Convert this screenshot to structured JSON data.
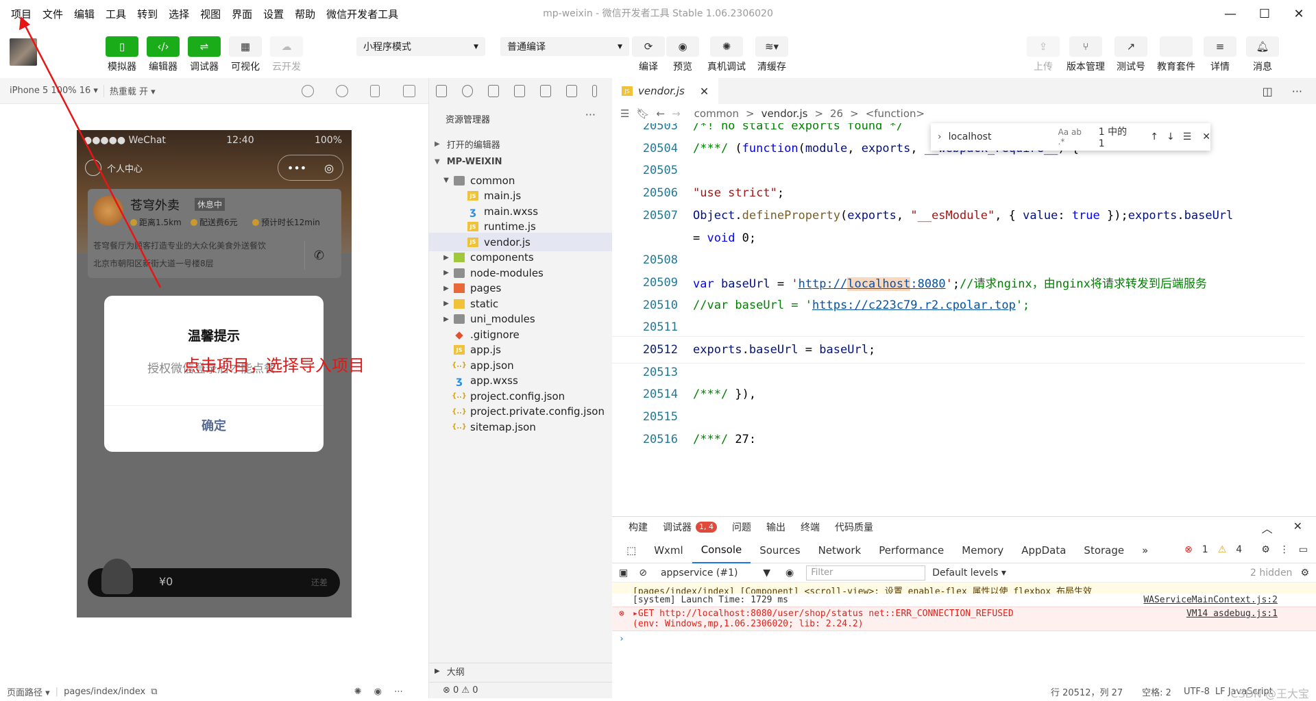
{
  "menubar": {
    "items": [
      "项目",
      "文件",
      "编辑",
      "工具",
      "转到",
      "选择",
      "视图",
      "界面",
      "设置",
      "帮助",
      "微信开发者工具"
    ]
  },
  "window": {
    "title": "mp-weixin - 微信开发者工具 Stable 1.06.2306020",
    "controls": {
      "minimize": "—",
      "maximize": "☐",
      "close": "✕"
    }
  },
  "toolbar": {
    "simulator": "模拟器",
    "editor": "编辑器",
    "debugger": "调试器",
    "visual": "可视化",
    "cloud": "云开发",
    "mode": "小程序模式",
    "compile_mode": "普通编译",
    "compile": "编译",
    "preview": "预览",
    "real_debug": "真机调试",
    "clear_cache": "清缓存",
    "upload": "上传",
    "version": "版本管理",
    "test": "测试号",
    "edu": "教育套件",
    "details": "详情",
    "messages": "消息"
  },
  "simbar": {
    "device": "iPhone 5 100% 16 ▾",
    "hotreload": "热重载 开 ▾"
  },
  "phone": {
    "status": {
      "carrier": "●●●●● WeChat",
      "time": "12:40",
      "battery": "100%"
    },
    "user": "个人中心",
    "shop": {
      "name": "苍穹外卖",
      "badge": "休息中",
      "distance": "距离1.5km",
      "fee": "配送费6元",
      "time": "预计时长12min",
      "desc": "苍穹餐厅为顾客打造专业的大众化美食外送餐饮",
      "address": "北京市朝阳区新街大道一号楼8层"
    },
    "dialog": {
      "title": "温馨提示",
      "message": "授权微信登录后才能点餐!",
      "ok": "确定"
    },
    "cart": {
      "price": "¥0",
      "note": "还差"
    }
  },
  "annotation": "点击项目，选择导入项目",
  "sim_footer": {
    "path_label": "页面路径 ▾",
    "path": "pages/index/index"
  },
  "explorer": {
    "title": "资源管理器",
    "open_editors": "打开的编辑器",
    "project": "MP-WEIXIN",
    "tree": [
      {
        "name": "common",
        "type": "folder",
        "depth": 1,
        "open": true
      },
      {
        "name": "main.js",
        "type": "js",
        "depth": 2
      },
      {
        "name": "main.wxss",
        "type": "wxss",
        "depth": 2
      },
      {
        "name": "runtime.js",
        "type": "js",
        "depth": 2
      },
      {
        "name": "vendor.js",
        "type": "js",
        "depth": 2,
        "selected": true
      },
      {
        "name": "components",
        "type": "fcom",
        "depth": 1
      },
      {
        "name": "node-modules",
        "type": "folder",
        "depth": 1
      },
      {
        "name": "pages",
        "type": "fpages",
        "depth": 1
      },
      {
        "name": "static",
        "type": "fstatic",
        "depth": 1
      },
      {
        "name": "uni_modules",
        "type": "folder",
        "depth": 1
      },
      {
        "name": ".gitignore",
        "type": "git",
        "depth": 1
      },
      {
        "name": "app.js",
        "type": "js",
        "depth": 1
      },
      {
        "name": "app.json",
        "type": "json",
        "depth": 1
      },
      {
        "name": "app.wxss",
        "type": "wxss",
        "depth": 1
      },
      {
        "name": "project.config.json",
        "type": "json",
        "depth": 1
      },
      {
        "name": "project.private.config.json",
        "type": "json",
        "depth": 1
      },
      {
        "name": "sitemap.json",
        "type": "json",
        "depth": 1
      }
    ],
    "outline": "大纲",
    "problems": "⊗ 0 ⚠ 0"
  },
  "editor": {
    "tab": "vendor.js",
    "breadcrumb": [
      "common",
      ">",
      "vendor.js",
      ">",
      "26",
      ">",
      "<function>"
    ],
    "find": {
      "query": "localhost",
      "count": "1 中的 1"
    },
    "lines": [
      {
        "n": "20503",
        "html": "<span class='cm'>/*! no static exports found */</span>"
      },
      {
        "n": "20504",
        "html": "<span class='cm'>/***/</span> (<span class='kw'>function</span>(<span class='vr'>module</span>, <span class='vr'>exports</span>, <span class='vr'>__webpack_require__</span>) {"
      },
      {
        "n": "20505",
        "html": ""
      },
      {
        "n": "20506",
        "html": "<span class='st'>\"use strict\"</span>;"
      },
      {
        "n": "20507",
        "html": "<span class='vr'>Object</span>.<span class='fn'>defineProperty</span>(<span class='vr'>exports</span>, <span class='st'>\"__esModule\"</span>, { <span class='vr'>value</span>: <span class='kw'>true</span> });<span class='vr'>exports</span>.<span class='vr'>baseUrl</span>"
      },
      {
        "n": "",
        "html": "= <span class='kw'>void</span> 0;"
      },
      {
        "n": "20508",
        "html": ""
      },
      {
        "n": "20509",
        "html": "<span class='kw'>var</span> <span class='vr'>baseUrl</span> = <span class='st'>'<span class='ur'>http://<span class='hl'>localhost</span>:8080</span>'</span>;<span class='cm'>//请求nginx，由nginx将请求转发到后端服务</span>"
      },
      {
        "n": "20510",
        "html": "<span class='cm'>//var baseUrl = '<span class='ur'>https://c223c79.r2.cpolar.top</span>';</span>"
      },
      {
        "n": "20511",
        "html": ""
      },
      {
        "n": "20512",
        "html": "<span class='vr'>exports</span>.<span class='vr'>baseUrl</span> = <span class='vr'>baseUrl</span>;",
        "current": true
      },
      {
        "n": "20513",
        "html": ""
      },
      {
        "n": "20514",
        "html": "<span class='cm'>/***/</span> }),"
      },
      {
        "n": "20515",
        "html": ""
      },
      {
        "n": "20516",
        "html": "<span class='cm'>/***/</span> 27:"
      }
    ]
  },
  "panel": {
    "tabs": [
      "构建",
      "调试器",
      "问题",
      "输出",
      "终端",
      "代码质量"
    ],
    "badge": "1, 4",
    "devtabs": [
      "Wxml",
      "Console",
      "Sources",
      "Network",
      "Performance",
      "Memory",
      "AppData",
      "Storage",
      "»"
    ],
    "errors": "1",
    "warnings": "4",
    "context": "appservice (#1)",
    "filter_placeholder": "Filter",
    "levels": "Default levels ▾",
    "hidden": "2 hidden",
    "logs": [
      {
        "text": "[pages/index/index] [Component] <scroll-view>: 设置 enable-flex 属性以使 flexbox 布局生效",
        "src": "",
        "type": "warn"
      },
      {
        "text": "[system] Launch Time: 1729 ms",
        "src": "WAServiceMainContext.js:2",
        "type": "info"
      },
      {
        "text": "▸GET http://localhost:8080/user/shop/status net::ERR_CONNECTION_REFUSED",
        "text2": "(env: Windows,mp,1.06.2306020; lib: 2.24.2)",
        "src": "VM14 asdebug.js:1",
        "type": "err"
      }
    ],
    "prompt": "›"
  },
  "status": {
    "pos": "行 20512，列 27",
    "spaces": "空格: 2",
    "encoding": "UTF-8",
    "lang": "LF  JavaScript",
    "watermark": "CSDN @王大宝"
  }
}
